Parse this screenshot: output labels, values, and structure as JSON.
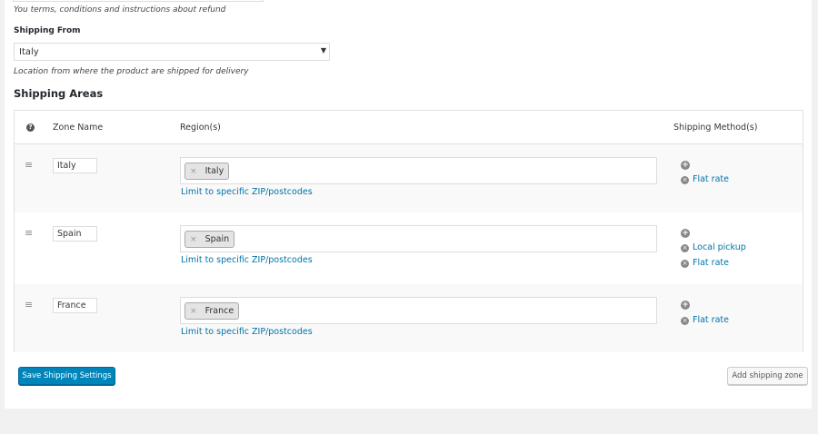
{
  "refund": {
    "hint": "You terms, conditions and instructions about refund"
  },
  "shipping_from": {
    "label": "Shipping From",
    "selected": "Italy",
    "hint": "Location from where the product are shipped for delivery"
  },
  "shipping_areas": {
    "title": "Shipping Areas",
    "headers": {
      "help": "?",
      "zone_name": "Zone Name",
      "regions": "Region(s)",
      "methods": "Shipping Method(s)"
    },
    "zones": [
      {
        "name": "Italy",
        "region": "Italy",
        "limit": "Limit to specific ZIP/postcodes",
        "methods": [
          "Flat rate"
        ]
      },
      {
        "name": "Spain",
        "region": "Spain",
        "limit": "Limit to specific ZIP/postcodes",
        "methods": [
          "Local pickup",
          "Flat rate"
        ]
      },
      {
        "name": "France",
        "region": "France",
        "limit": "Limit to specific ZIP/postcodes",
        "methods": [
          "Flat rate"
        ]
      }
    ]
  },
  "icons": {
    "drag": "≡",
    "add": "+",
    "remove": "×",
    "dropdown": "▼"
  },
  "actions": {
    "save": "Save Shipping Settings",
    "add_zone": "Add shipping zone"
  },
  "colors": {
    "primary": "#0085ba",
    "link": "#0073aa",
    "page_bg": "#f1f1f1"
  }
}
